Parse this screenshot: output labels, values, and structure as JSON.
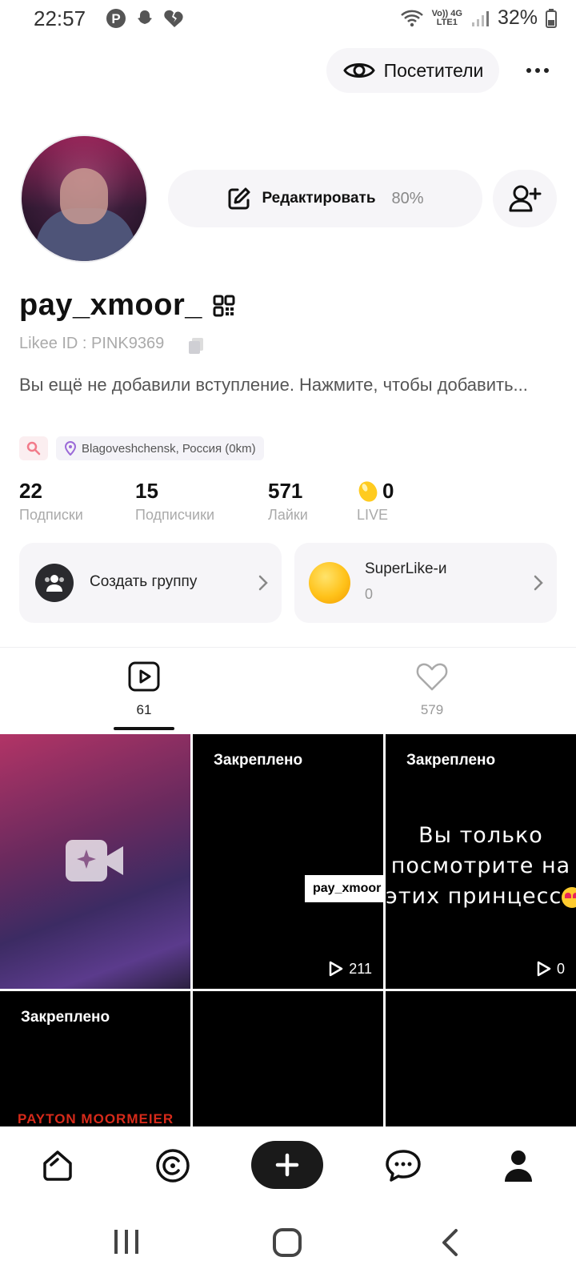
{
  "status_bar": {
    "time": "22:57",
    "network_top": "Vo)) 4G",
    "network_bottom": "LTE1",
    "battery": "32%"
  },
  "header": {
    "visitors_label": "Посетители",
    "more_icon": "more-horizontal-icon"
  },
  "profile": {
    "edit_label": "Редактировать",
    "edit_percent": "80%",
    "username": "pay_xmoor_",
    "likee_id": "Likee ID : PINK9369",
    "bio": "Вы ещё не добавили вступление. Нажмите, чтобы добавить...",
    "location": "Blagoveshchensk, Россия (0km)"
  },
  "stats": [
    {
      "value": "22",
      "label": "Подписки"
    },
    {
      "value": "15",
      "label": "Подписчики"
    },
    {
      "value": "571",
      "label": "Лайки"
    },
    {
      "value": "0",
      "label": "LIVE"
    }
  ],
  "cards": {
    "group_label": "Создать группу",
    "superlike_title": "SuperLike-и",
    "superlike_count": "0"
  },
  "tabs": {
    "videos_count": "61",
    "likes_count": "579"
  },
  "grid": {
    "pinned_label": "Закреплено",
    "cell2_views": "211",
    "cell2_watermark": "pay_xmoor",
    "cell3_line1": "Вы только",
    "cell3_line2": "посмотрите на",
    "cell3_line3": "этих принцесс",
    "cell3_views": "0",
    "cell4_text": "PAYTON MOORMEIER"
  },
  "colors": {
    "accent_dark": "#1a1a1a",
    "surface": "#f6f5f8",
    "muted_text": "#aaaaaa"
  }
}
